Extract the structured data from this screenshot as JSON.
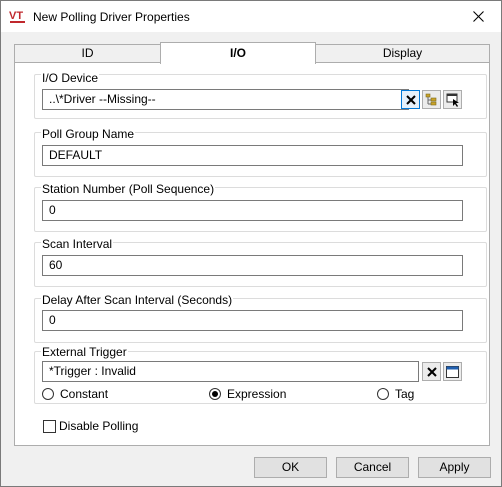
{
  "window": {
    "title": "New Polling Driver Properties",
    "logo_text": "VT"
  },
  "tabs": [
    {
      "label": "ID"
    },
    {
      "label": "I/O",
      "active": true
    },
    {
      "label": "Display"
    }
  ],
  "io_device": {
    "label": "I/O Device",
    "value": "..\\*Driver    --Missing--"
  },
  "poll_group": {
    "label": "Poll Group Name",
    "value": "DEFAULT"
  },
  "station_number": {
    "label": "Station Number (Poll Sequence)",
    "value": "0"
  },
  "scan_interval": {
    "label": "Scan Interval",
    "value": "60"
  },
  "delay_after_scan": {
    "label": "Delay After Scan Interval (Seconds)",
    "value": "0"
  },
  "external_trigger": {
    "label": "External Trigger",
    "value": "*Trigger : Invalid",
    "options": [
      "Constant",
      "Expression",
      "Tag"
    ],
    "selected": "Expression"
  },
  "disable_polling": {
    "label": "Disable Polling",
    "checked": false
  },
  "buttons": {
    "ok": "OK",
    "cancel": "Cancel",
    "apply": "Apply"
  },
  "colors": {
    "accent": "#0078d7",
    "logo_red": "#c0282d"
  },
  "icons": [
    "app-logo-icon",
    "close-icon",
    "clear-icon",
    "tree-browse-icon",
    "select-icon",
    "window-icon"
  ]
}
